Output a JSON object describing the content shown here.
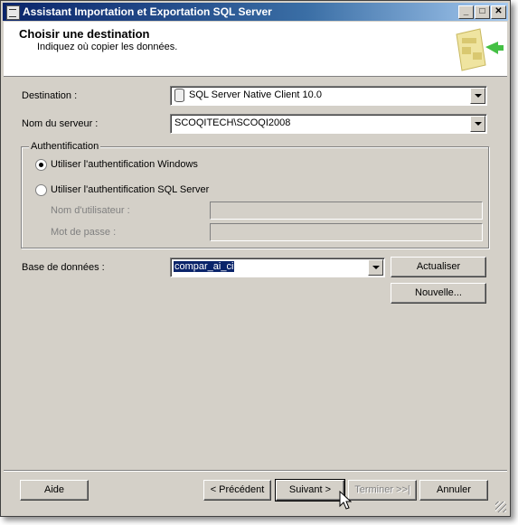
{
  "window": {
    "title": "Assistant Importation et Exportation SQL Server"
  },
  "header": {
    "title": "Choisir une destination",
    "subtitle": "Indiquez où copier les données."
  },
  "destination": {
    "label": "Destination :",
    "value": "SQL Server Native Client 10.0"
  },
  "server": {
    "label": "Nom du serveur :",
    "value": "SCOQITECH\\SCOQI2008"
  },
  "auth": {
    "group_label": "Authentification",
    "windows_label": "Utiliser l'authentification Windows",
    "sql_label": "Utiliser l'authentification SQL Server",
    "username_label": "Nom d'utilisateur :",
    "password_label": "Mot de passe :"
  },
  "database": {
    "label": "Base de données :",
    "value": "compar_ai_ci",
    "refresh_label": "Actualiser",
    "new_label": "Nouvelle..."
  },
  "buttons": {
    "help": "Aide",
    "previous": "< Précédent",
    "next": "Suivant >",
    "finish": "Terminer >>|",
    "cancel": "Annuler"
  }
}
